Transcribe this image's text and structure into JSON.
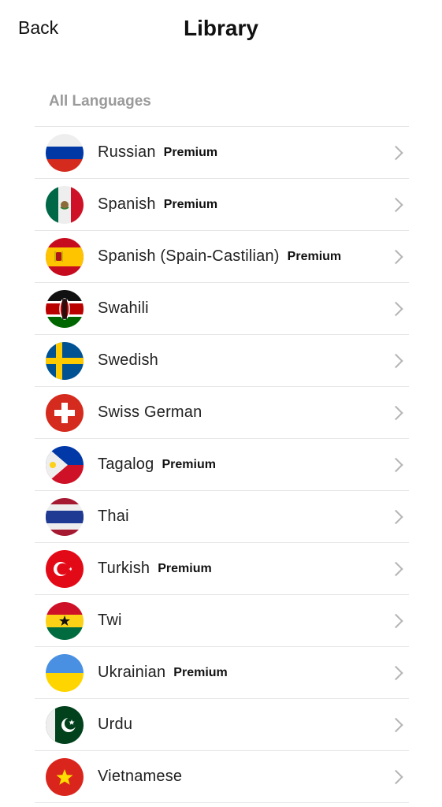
{
  "header": {
    "back_label": "Back",
    "title": "Library"
  },
  "section_label": "All Languages",
  "languages": [
    {
      "name": "Russian",
      "badge": "Premium",
      "flag": "russia-flag-icon"
    },
    {
      "name": "Spanish",
      "badge": "Premium",
      "flag": "mexico-flag-icon"
    },
    {
      "name": "Spanish (Spain-Castilian)",
      "badge": "Premium",
      "flag": "spain-flag-icon"
    },
    {
      "name": "Swahili",
      "badge": "",
      "flag": "kenya-flag-icon"
    },
    {
      "name": "Swedish",
      "badge": "",
      "flag": "sweden-flag-icon"
    },
    {
      "name": "Swiss German",
      "badge": "",
      "flag": "switzerland-flag-icon"
    },
    {
      "name": "Tagalog",
      "badge": "Premium",
      "flag": "philippines-flag-icon"
    },
    {
      "name": "Thai",
      "badge": "",
      "flag": "thailand-flag-icon"
    },
    {
      "name": "Turkish",
      "badge": "Premium",
      "flag": "turkey-flag-icon"
    },
    {
      "name": "Twi",
      "badge": "",
      "flag": "ghana-flag-icon"
    },
    {
      "name": "Ukrainian",
      "badge": "Premium",
      "flag": "ukraine-flag-icon"
    },
    {
      "name": "Urdu",
      "badge": "",
      "flag": "pakistan-flag-icon"
    },
    {
      "name": "Vietnamese",
      "badge": "",
      "flag": "vietnam-flag-icon"
    }
  ]
}
